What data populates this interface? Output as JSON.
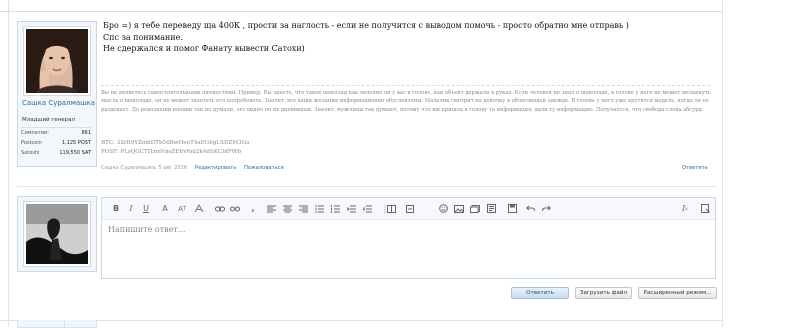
{
  "post": {
    "author": {
      "name": "Сашка Суралмашка",
      "title": "Младший генерал",
      "stats": [
        {
          "label": "Симпатии:",
          "value": "861"
        },
        {
          "label": "Postcoin",
          "value": "1,125 POST"
        },
        {
          "label": "Satoshi",
          "value": "119,550 SAT"
        }
      ]
    },
    "message_lines": [
      "Бро =) я тебе переведу ща 400К , прости за наглость - если не получится с выводом помочь - просто обратно мне отправь )",
      "Спс за понимание.",
      "Не сдержался и помог Фанату вывести Сатохи)"
    ],
    "signature": "Вы не являетесь самостоятельными личностями. Пример. Вы знаете, что такое шоколад как явление он у вас в голове, как объект держали в руках. Если человек не знал о шоколаде, в голове у него не может мелькнуть мысль о шоколаде, он не может захотеть его попробовать. Значит, все ваши желания информационно обусловлены. Мальчик смотрит на девочку в облегающей одежде. В голове у него уже крутится модель, когда он ее раздевает. До революции юноши так не думали, это видно по их дневникам. Значит, мужчины так думают, потому что им пришла в голову та информация, дали ту информацию. Получается, что свобода слова абсурд.",
    "btc": "BTC: 32rB9YZmhDTb56BwHeoT4aEG6gLSDZM3Go",
    "post_addr": "POST: PLsQGCTHzmVnsZEbV6nl2k4dSKCbfFWb",
    "meta": {
      "author": "Сашка Суралмашка,",
      "date": "5 авг 2016",
      "edit": "Редактировать",
      "report": "Пожаловаться",
      "reply": "Ответить"
    }
  },
  "editor": {
    "placeholder": "Напишите ответ...",
    "buttons": {
      "reply": "Ответить",
      "upload": "Загрузить файл",
      "advanced": "Расширенный режим..."
    }
  },
  "colors": {
    "link": "#2d6aa0",
    "card_border": "#c9d9e8",
    "card_bg": "#f3f7fb"
  }
}
